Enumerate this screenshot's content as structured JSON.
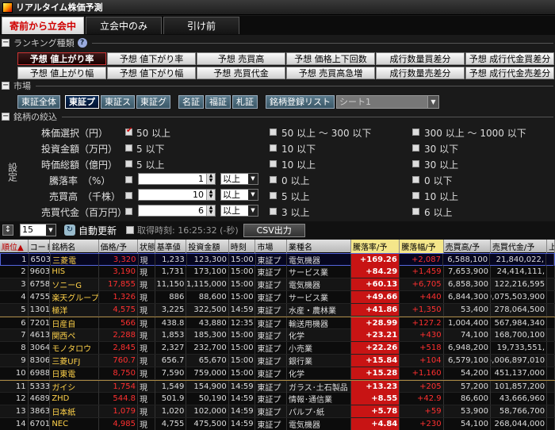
{
  "window": {
    "title": "リアルタイム株価予測"
  },
  "tabs": [
    {
      "label": "寄前から立会中"
    },
    {
      "label": "立会中のみ"
    },
    {
      "label": "引け前"
    }
  ],
  "ranking": {
    "header": "ランキング種類",
    "buttons": [
      "予想 値上がり率",
      "予想 値下がり率",
      "予想 売買高",
      "予想 価格上下回数",
      "成行数量買差分",
      "予想 成行代金買差分",
      "予想 値上がり幅",
      "予想 値下がり幅",
      "予想 売買代金",
      "予想 売買高急増",
      "成行数量売差分",
      "予想 成行代金売差分"
    ],
    "selected_index": 0
  },
  "market": {
    "header": "市場",
    "buttons": [
      "東証全体",
      "東証プ",
      "東証ス",
      "東証グ",
      "名証",
      "福証",
      "札証"
    ],
    "selected_index": 1,
    "watchlist_button": "銘柄登録リスト",
    "sheet_value": "シート1"
  },
  "filter": {
    "header": "銘柄の絞込",
    "side_label": "設定",
    "rows": [
      {
        "label": "株価選択（円）",
        "c1": "50 以上",
        "c1_on": true,
        "c2": "50 以上 ～ 300 以下",
        "c3": "300 以上 ～ 1000 以下"
      },
      {
        "label": "投資金額（万円）",
        "c1": "5 以下",
        "c1_on": false,
        "c2": "10 以下",
        "c3": "30 以下"
      },
      {
        "label": "時価総額（億円）",
        "c1": "5 以上",
        "c1_on": false,
        "c2": "10 以上",
        "c3": "30 以上"
      },
      {
        "label": "騰落率　（%）",
        "num": "1",
        "cond": "以上",
        "c2": "0 以上",
        "c3": "0 以下"
      },
      {
        "label": "売買高　（千株）",
        "num": "10",
        "cond": "以上",
        "c2": "5 以上",
        "c3": "10 以上"
      },
      {
        "label": "売買代金（百万円）",
        "num": "6",
        "cond": "以上",
        "c2": "3 以上",
        "c3": "6 以上"
      }
    ]
  },
  "toolbar": {
    "count_value": "15",
    "auto_refresh_label": "自動更新",
    "acquired_time": "取得時刻: 16:25:32 (-秒)",
    "csv_label": "CSV出力"
  },
  "table": {
    "columns": [
      "順位▲",
      "コード",
      "銘柄名",
      "価格/予",
      "状態",
      "基準値",
      "投資金額",
      "時刻",
      "市場",
      "業種名",
      "騰落率/予",
      "騰落幅/予",
      "売買高/予",
      "売買代金/予",
      "上"
    ],
    "rows": [
      [
        "1",
        "6503",
        "三菱電",
        "3,320",
        "現",
        "1,233",
        "123,300",
        "15:00",
        "東証プ",
        "電気機器",
        "+169.26",
        "+2,087",
        "6,588,100",
        "21,840,022,",
        ""
      ],
      [
        "2",
        "9603",
        "HIS",
        "3,190",
        "現",
        "1,731",
        "173,100",
        "15:00",
        "東証プ",
        "サービス業",
        "+84.29",
        "+1,459",
        "7,653,900",
        "24,414,111,",
        ""
      ],
      [
        "3",
        "6758",
        "ソニーG",
        "17,855",
        "現",
        "11,150",
        "1,115,000",
        "15:00",
        "東証プ",
        "電気機器",
        "+60.13",
        "+6,705",
        "6,858,300",
        "122,216,595",
        ""
      ],
      [
        "4",
        "4755",
        "楽天グループ",
        "1,326",
        "現",
        "886",
        "88,600",
        "15:00",
        "東証プ",
        "サービス業",
        "+49.66",
        "+440",
        "6,844,300",
        "9,075,503,900",
        ""
      ],
      [
        "5",
        "1301",
        "極洋",
        "4,575",
        "現",
        "3,225",
        "322,500",
        "14:59",
        "東証プ",
        "水産・農林業",
        "+41.86",
        "+1,350",
        "53,400",
        "278,064,500",
        ""
      ],
      [
        "6",
        "7201",
        "日産自",
        "566",
        "現",
        "438.8",
        "43,880",
        "12:35",
        "東証プ",
        "輸送用機器",
        "+28.99",
        "+127.2",
        "1,004,400",
        "567,984,340",
        ""
      ],
      [
        "7",
        "4613",
        "関西ペ",
        "2,288",
        "現",
        "1,853",
        "185,300",
        "15:00",
        "東証プ",
        "化学",
        "+23.21",
        "+430",
        "74,100",
        "168,700,100",
        ""
      ],
      [
        "8",
        "3064",
        "モノタロウ",
        "2,845",
        "現",
        "2,327",
        "232,700",
        "15:00",
        "東証プ",
        "小売業",
        "+22.26",
        "+518",
        "6,948,200",
        "19,733,551,",
        ""
      ],
      [
        "9",
        "8306",
        "三菱UFJ",
        "760.7",
        "現",
        "656.7",
        "65,670",
        "15:00",
        "東証プ",
        "銀行業",
        "+15.84",
        "+104",
        "6,579,100",
        "5,006,897,010",
        ""
      ],
      [
        "10",
        "6988",
        "日東電",
        "8,750",
        "現",
        "7,590",
        "759,000",
        "15:00",
        "東証プ",
        "化学",
        "+15.28",
        "+1,160",
        "54,200",
        "451,137,000",
        ""
      ],
      [
        "11",
        "5333",
        "ガイシ",
        "1,754",
        "現",
        "1,549",
        "154,900",
        "14:59",
        "東証プ",
        "ガラス･土石製品",
        "+13.23",
        "+205",
        "57,200",
        "101,857,200",
        ""
      ],
      [
        "12",
        "4689",
        "ZHD",
        "544.8",
        "現",
        "501.9",
        "50,190",
        "14:59",
        "東証プ",
        "情報･通信業",
        "+8.55",
        "+42.9",
        "86,600",
        "43,666,960",
        ""
      ],
      [
        "13",
        "3863",
        "日本紙",
        "1,079",
        "現",
        "1,020",
        "102,000",
        "14:59",
        "東証プ",
        "パルプ･紙",
        "+5.78",
        "+59",
        "53,900",
        "58,766,700",
        ""
      ],
      [
        "14",
        "6701",
        "NEC",
        "4,985",
        "現",
        "4,755",
        "475,500",
        "14:59",
        "東証プ",
        "電気機器",
        "+4.84",
        "+230",
        "54,100",
        "268,044,000",
        ""
      ]
    ]
  },
  "colors": {
    "accent_red": "#c81414",
    "name_yellow": "#ffd24a",
    "selected_blue": "#001230"
  }
}
